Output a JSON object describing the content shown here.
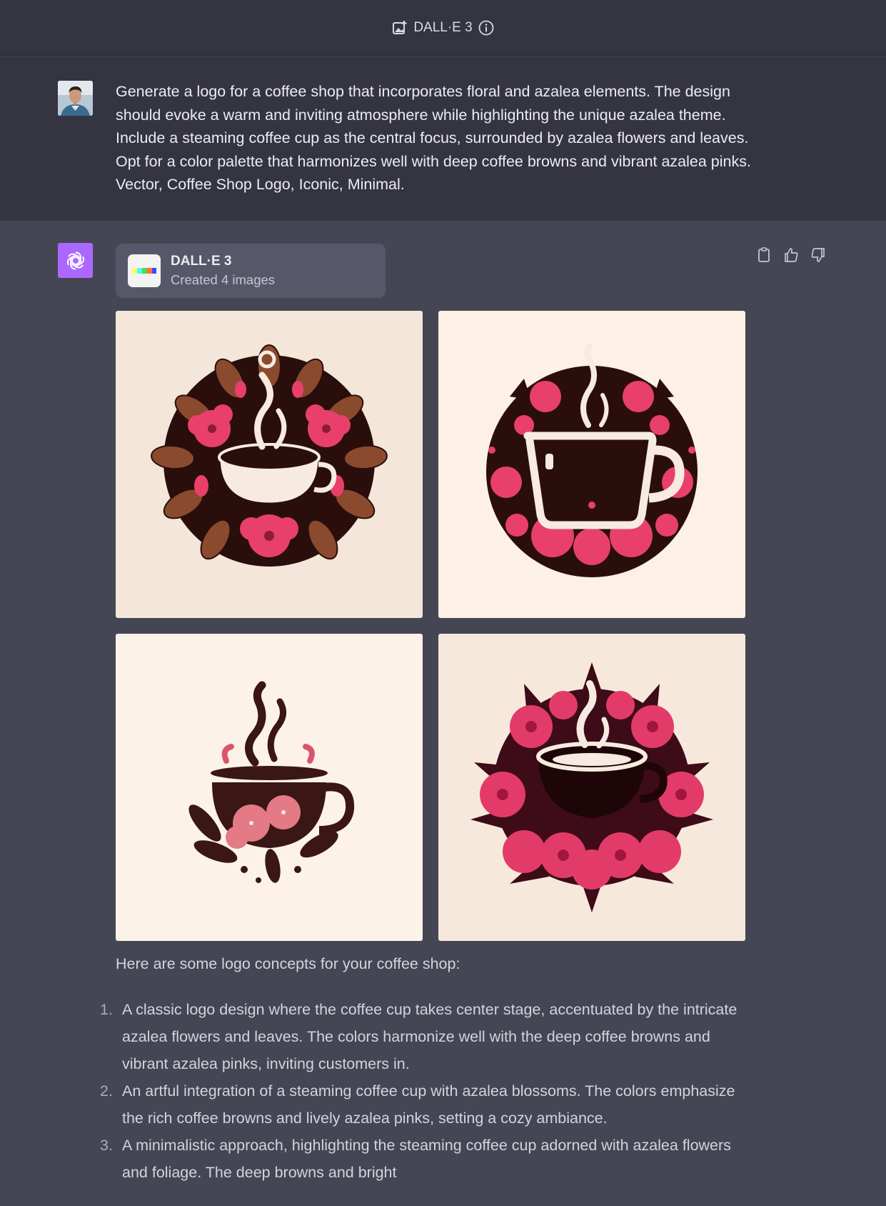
{
  "header": {
    "model_label": "DALL·E 3",
    "icons": [
      "image-plus-icon",
      "info-icon"
    ]
  },
  "user_message": {
    "text": "Generate a logo for a coffee shop that incorporates floral and azalea elements. The design should evoke a warm and inviting atmosphere while highlighting the unique azalea theme. Include a steaming coffee cup as the central focus, surrounded by azalea flowers and leaves. Opt for a color palette that harmonizes well with deep coffee browns and vibrant azalea pinks. Vector, Coffee Shop Logo, Iconic, Minimal."
  },
  "assistant": {
    "tool_card": {
      "title": "DALL·E 3",
      "subtitle": "Created 4 images"
    },
    "actions": [
      "copy-icon",
      "thumbs-up-icon",
      "thumbs-down-icon"
    ],
    "intro": "Here are some logo concepts for your coffee shop:",
    "items": [
      {
        "num": "1.",
        "text": "A classic logo design where the coffee cup takes center stage, accentuated by the intricate azalea flowers and leaves. The colors harmonize well with the deep coffee browns and vibrant azalea pinks, inviting customers in."
      },
      {
        "num": "2.",
        "text": "An artful integration of a steaming coffee cup with azalea blossoms. The colors emphasize the rich coffee browns and lively azalea pinks, setting a cozy ambiance."
      },
      {
        "num": "3.",
        "text": "A minimalistic approach, highlighting the steaming coffee cup adorned with azalea flowers and foliage. The deep browns and bright"
      }
    ]
  },
  "colors": {
    "header_bg": "#343541",
    "assistant_bg": "#444654",
    "gpt_accent": "#ab68ff",
    "coffee_brown": "#2b0f0d",
    "azalea_pink": "#e8406a",
    "cream": "#fdf0e4"
  }
}
